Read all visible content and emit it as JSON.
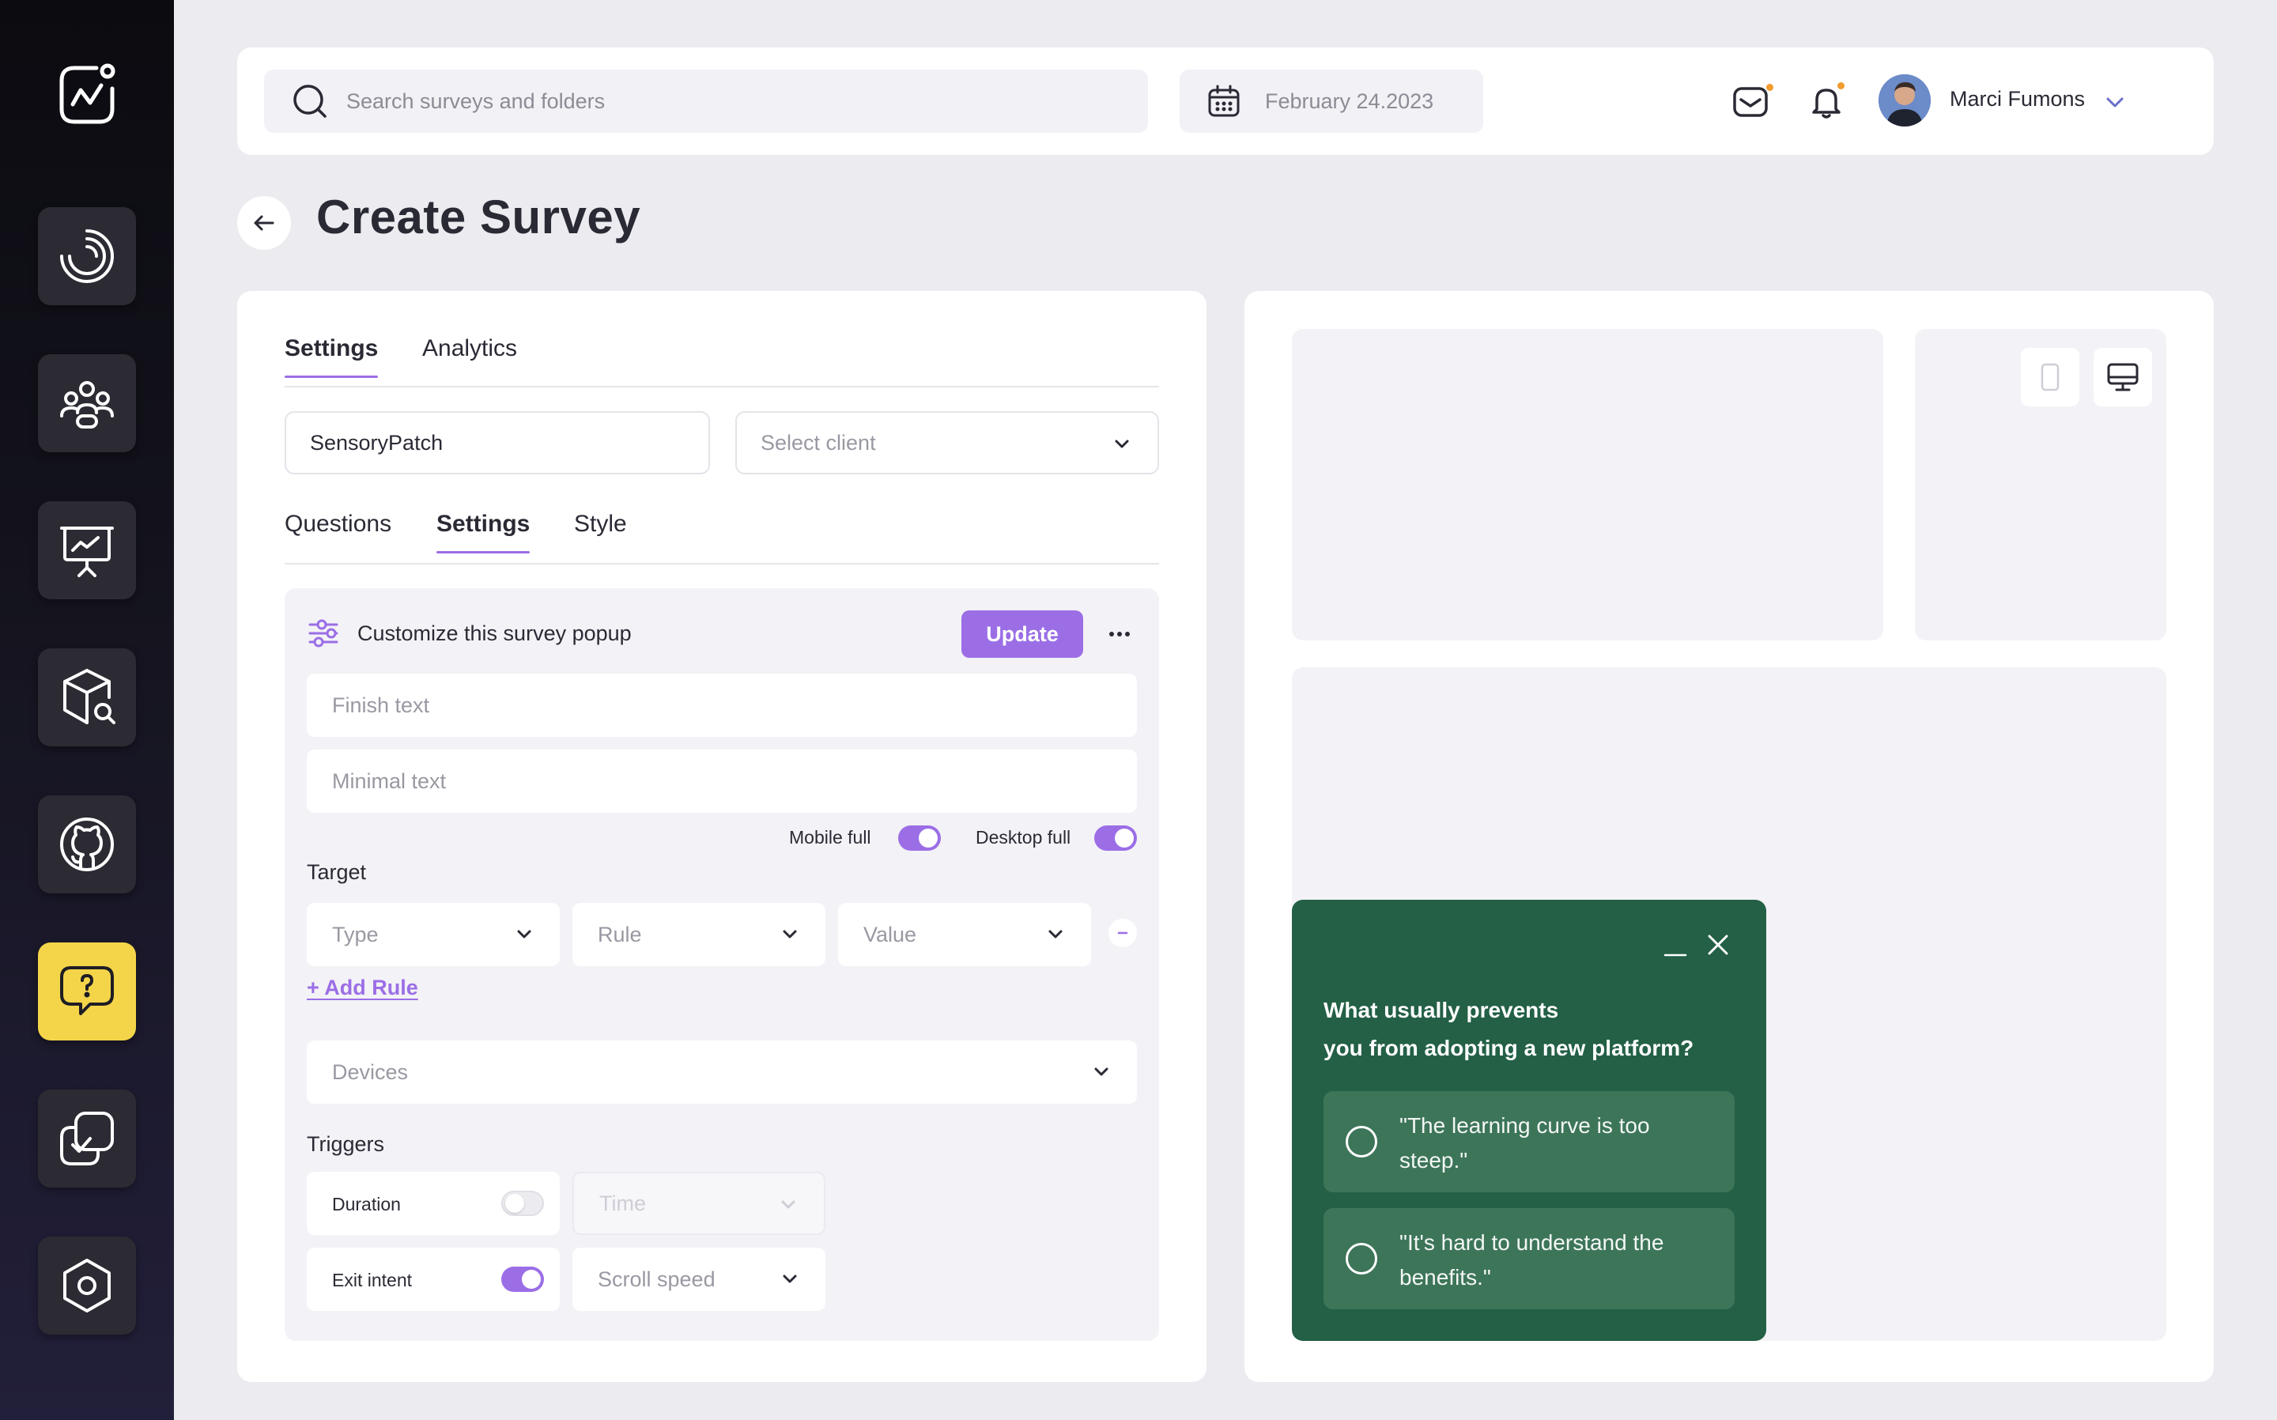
{
  "colors": {
    "accent": "#9b6ee6",
    "active_nav": "#f4d54a",
    "popup_bg": "#236046",
    "notification_dot": "#f29b2f"
  },
  "sidebar": {
    "logo_icon": "activity-chart-icon",
    "items": [
      {
        "icon": "dashboard-icon"
      },
      {
        "icon": "users-group-icon"
      },
      {
        "icon": "presentation-chart-icon"
      },
      {
        "icon": "product-search-icon"
      },
      {
        "icon": "github-icon"
      },
      {
        "icon": "survey-question-icon",
        "active": true
      },
      {
        "icon": "tasks-check-icon"
      },
      {
        "icon": "settings-hexagon-icon"
      }
    ]
  },
  "header": {
    "search_placeholder": "Search surveys and folders",
    "date": "February 24.2023",
    "user_name": "Marci Fumons"
  },
  "page": {
    "title": "Create Survey"
  },
  "left": {
    "tabs": [
      "Settings",
      "Analytics"
    ],
    "active_tab": "Settings",
    "name_value": "SensoryPatch",
    "client_placeholder": "Select client",
    "sub_tabs": [
      "Questions",
      "Settings",
      "Style"
    ],
    "active_sub_tab": "Settings",
    "panel": {
      "title": "Customize this survey popup",
      "update_label": "Update",
      "finish_placeholder": "Finish text",
      "minimal_placeholder": "Minimal text",
      "mobile_full_label": "Mobile full",
      "mobile_full_on": true,
      "desktop_full_label": "Desktop full",
      "desktop_full_on": true,
      "target_label": "Target",
      "type_placeholder": "Type",
      "rule_placeholder": "Rule",
      "value_placeholder": "Value",
      "add_rule_label": "+ Add Rule",
      "devices_placeholder": "Devices",
      "triggers_label": "Triggers",
      "duration_label": "Duration",
      "duration_on": false,
      "time_placeholder": "Time",
      "exit_intent_label": "Exit intent",
      "exit_intent_on": true,
      "scroll_speed_placeholder": "Scroll speed"
    }
  },
  "preview": {
    "question_line1": "What usually prevents",
    "question_line2": "you from adopting a new platform?",
    "options": [
      "\"The learning curve is too steep.\"",
      "\"It's hard to understand the benefits.\""
    ]
  }
}
